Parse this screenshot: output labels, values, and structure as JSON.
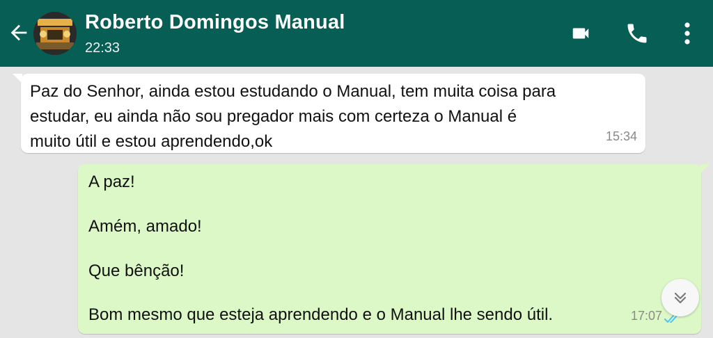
{
  "header": {
    "contact_name": "Roberto Domingos Manual",
    "last_seen": "22:33",
    "icons": [
      "back-arrow",
      "avatar",
      "video-call",
      "phone",
      "more-vertical"
    ],
    "colors": {
      "bar": "#075e54",
      "text": "#ffffff"
    }
  },
  "messages": [
    {
      "direction": "incoming",
      "lines": [
        "Paz do Senhor, ainda estou estudando o Manual, tem muita coisa para",
        "estudar, eu ainda não sou pregador mais com certeza o Manual é",
        "muito útil e estou aprendendo,ok"
      ],
      "time": "15:34",
      "bg": "#ffffff"
    },
    {
      "direction": "outgoing",
      "lines": [
        "A paz!",
        "Amém, amado!",
        "Que bênção!",
        "Bom mesmo que esteja aprendendo e o Manual lhe sendo útil."
      ],
      "time": "17:07",
      "status": "read",
      "bg": "#dcf8c6"
    }
  ],
  "chat": {
    "background": "#e5e5e5",
    "scroll_button_icon": "double-chevron-down"
  }
}
